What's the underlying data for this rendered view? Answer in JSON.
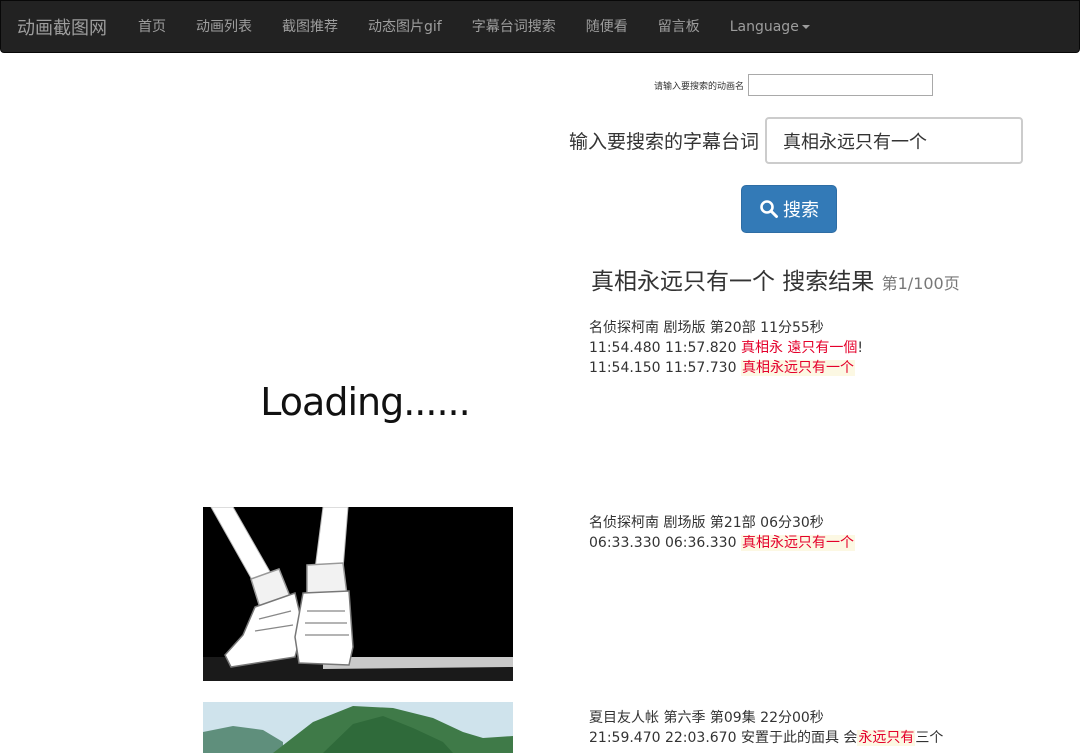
{
  "navbar": {
    "brand": "动画截图网",
    "items": [
      {
        "label": "首页"
      },
      {
        "label": "动画列表"
      },
      {
        "label": "截图推荐"
      },
      {
        "label": "动态图片gif"
      },
      {
        "label": "字幕台词搜索"
      },
      {
        "label": "随便看"
      },
      {
        "label": "留言板"
      },
      {
        "label": "Language"
      }
    ]
  },
  "anime_search": {
    "label": "请输入要搜索的动画名",
    "value": ""
  },
  "subtitle_search": {
    "label": "输入要搜索的字幕台词",
    "value": "真相永远只有一个",
    "button_label": "搜索"
  },
  "results_header": {
    "query": "真相永远只有一个",
    "suffix": " 搜索结果",
    "page": "第1/100页"
  },
  "loading_text": "Loading......",
  "results": [
    {
      "source": "名侦探柯南 剧场版 第20部 11分55秒",
      "lines": [
        {
          "time": "11:54.480 11:57.820",
          "before": "",
          "match": "真相永 遠只有一個",
          "after": "!",
          "match_style": "plain"
        },
        {
          "time": "11:54.150 11:57.730",
          "before": "",
          "match": "真相永远只有一个",
          "after": "",
          "match_style": "box"
        }
      ]
    },
    {
      "source": "名侦探柯南 剧场版 第21部 06分30秒",
      "lines": [
        {
          "time": "06:33.330 06:36.330",
          "before": "",
          "match": "真相永远只有一个",
          "after": "",
          "match_style": "box"
        }
      ]
    },
    {
      "source": "夏目友人帐 第六季 第09集 22分00秒",
      "lines": [
        {
          "time": "21:59.470 22:03.670",
          "before": "安置于此的面具 会",
          "match": "永远只有",
          "after": "三个",
          "match_style": "box"
        }
      ]
    }
  ],
  "colors": {
    "navbar_bg": "#222222",
    "navbar_text": "#9d9d9d",
    "button_primary": "#337ab7",
    "highlight_text": "#e4002b",
    "highlight_bg": "#fcf8e3"
  }
}
